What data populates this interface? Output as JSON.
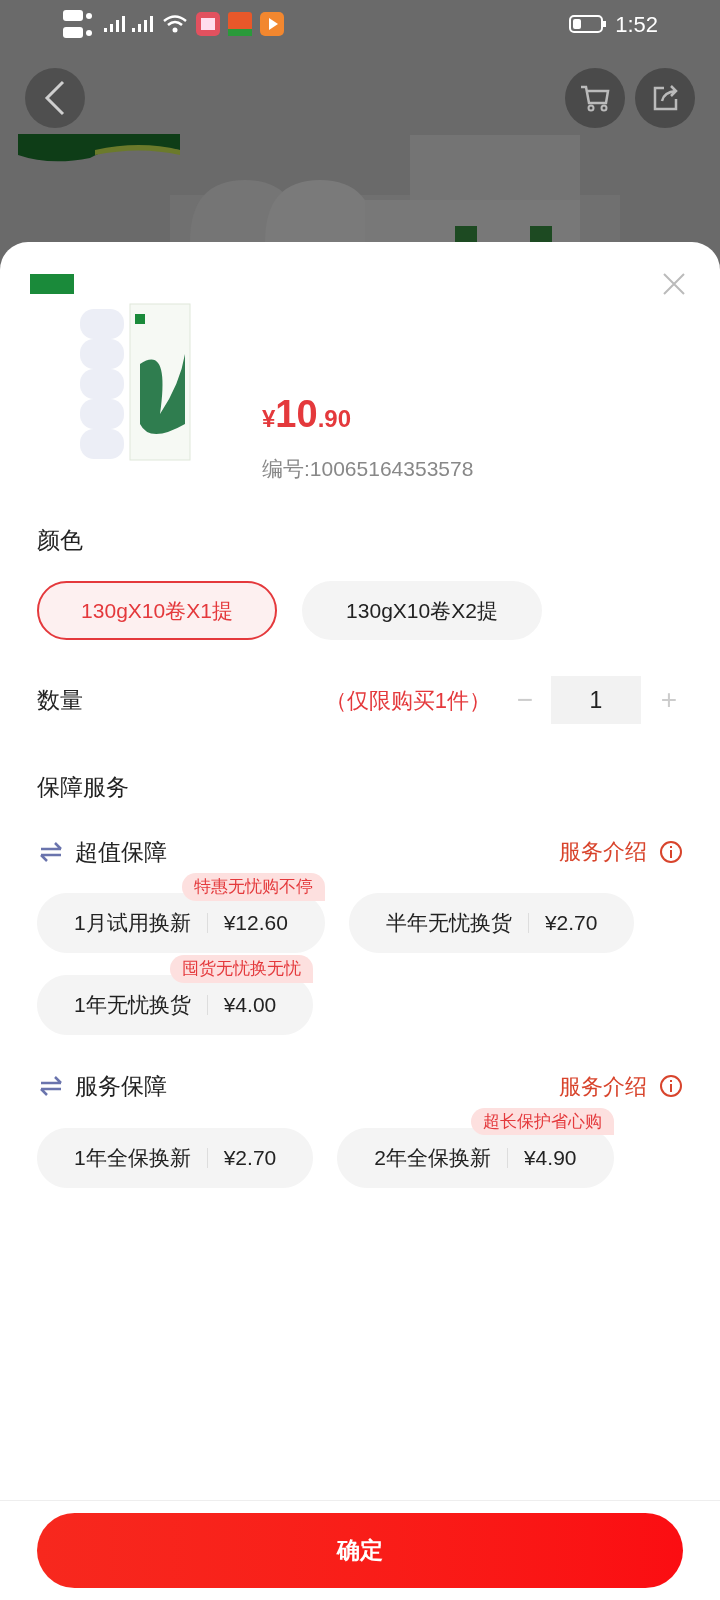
{
  "status_bar": {
    "time": "1:52"
  },
  "product": {
    "price_symbol": "¥",
    "price_int": "10",
    "price_dec": ".90",
    "sku": "编号:10065164353578"
  },
  "color": {
    "title": "颜色",
    "options": [
      {
        "label": "130gX10卷X1提",
        "selected": true
      },
      {
        "label": "130gX10卷X2提",
        "selected": false
      }
    ]
  },
  "quantity": {
    "title": "数量",
    "note": "（仅限购买1件）",
    "value": "1",
    "minus": "−",
    "plus": "+",
    "minus_disabled": true,
    "plus_disabled": true
  },
  "protection": {
    "title": "保障服务",
    "groups": [
      {
        "title": "超值保障",
        "link": "服务介绍",
        "rows": [
          [
            {
              "name": "1月试用换新",
              "price": "¥12.60",
              "tag": "特惠无忧购不停",
              "selected": false
            },
            {
              "name": "半年无忧换货",
              "price": "¥2.70",
              "selected": false
            }
          ],
          [
            {
              "name": "1年无忧换货",
              "price": "¥4.00",
              "tag": "囤货无忧换无忧",
              "selected": false
            }
          ]
        ]
      },
      {
        "title": "服务保障",
        "link": "服务介绍",
        "rows": [
          [
            {
              "name": "1年全保换新",
              "price": "¥2.70",
              "selected": false
            },
            {
              "name": "2年全保换新",
              "price": "¥4.90",
              "tag": "超长保护省心购",
              "selected": false
            }
          ]
        ]
      }
    ]
  },
  "confirm_button": "确定"
}
